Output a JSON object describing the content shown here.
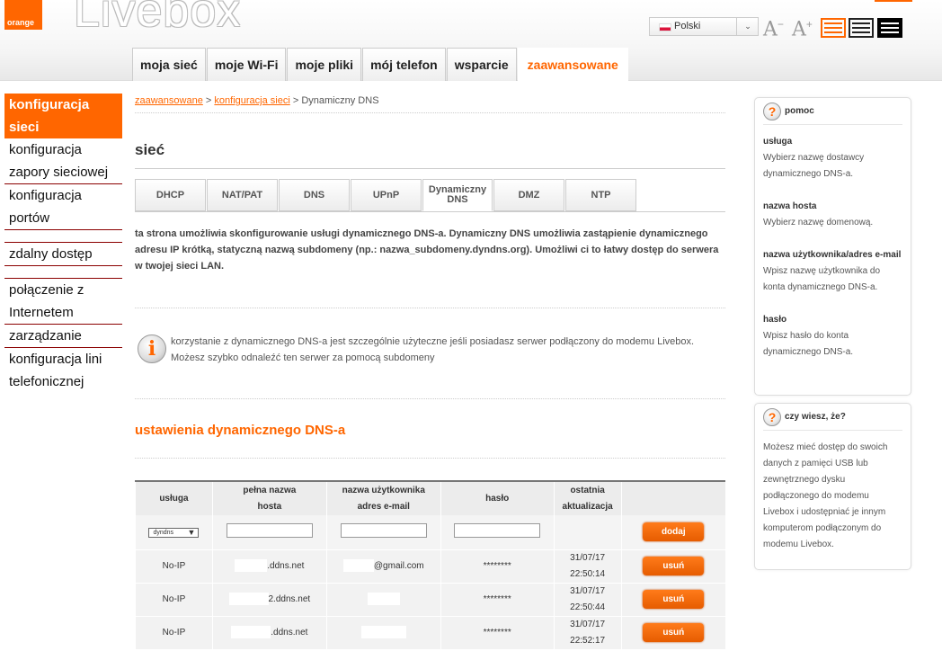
{
  "header": {
    "logo_text": "orange",
    "brand": "Livebox",
    "language": "Polski",
    "font_decrease": "A",
    "font_increase": "A",
    "font_decrease_mark": "−",
    "font_increase_mark": "+"
  },
  "main_tabs": [
    "moja sieć",
    "moje Wi-Fi",
    "moje pliki",
    "mój telefon",
    "wsparcie",
    "zaawansowane"
  ],
  "left_nav": [
    "konfiguracja sieci",
    "konfiguracja zapory sieciowej",
    "konfiguracja portów",
    "zdalny dostęp",
    "połączenie z Internetem",
    "zarządzanie",
    "konfiguracja lini telefonicznej"
  ],
  "breadcrumb": {
    "level1": "zaawansowane",
    "level2": "konfiguracja sieci",
    "sep": ">",
    "current": "Dynamiczny DNS"
  },
  "section_title": "sieć",
  "sub_tabs": [
    "DHCP",
    "NAT/PAT",
    "DNS",
    "UPnP",
    "Dynamiczny DNS",
    "DMZ",
    "NTP"
  ],
  "description": "ta strona umożliwia skonfigurowanie usługi dynamicznego DNS-a. Dynamiczny DNS umożliwia zastąpienie dynamicznego adresu IP krótką, statyczną nazwą subdomeny (np.: nazwa_subdomeny.dyndns.org). Umożliwi ci to łatwy dostęp do serwera w twojej sieci LAN.",
  "info": {
    "icon": "i",
    "text": "korzystanie z dynamicznego DNS-a jest szczególnie użyteczne jeśli posiadasz serwer podłączony do modemu Livebox. Możesz szybko odnaleźć ten serwer za pomocą subdomeny"
  },
  "settings_title": "ustawienia dynamicznego DNS-a",
  "table": {
    "headers": [
      "usługa",
      "pełna nazwa hosta",
      "nazwa użytkownika adres e-mail",
      "hasło",
      "ostatnia aktualizacja"
    ],
    "input_row": {
      "service_select": "dyndns",
      "host": "",
      "user": "",
      "password": "",
      "add_button": "dodaj"
    },
    "rows": [
      {
        "service": "No-IP",
        "host": ".ddns.net",
        "user": "@gmail.com",
        "password": "********",
        "date": "31/07/17",
        "time": "22:50:14",
        "button": "usuń"
      },
      {
        "service": "No-IP",
        "host": "2.ddns.net",
        "user": "",
        "password": "********",
        "date": "31/07/17",
        "time": "22:50:44",
        "button": "usuń"
      },
      {
        "service": "No-IP",
        "host": ".ddns.net",
        "user": "",
        "password": "********",
        "date": "31/07/17",
        "time": "22:52:17",
        "button": "usuń"
      }
    ]
  },
  "help": {
    "title": "pomoc",
    "icon": "?",
    "items": [
      {
        "label": "usługa",
        "desc": "Wybierz nazwę dostawcy dynamicznego DNS-a."
      },
      {
        "label": "nazwa hosta",
        "desc": "Wybierz nazwę domenową."
      },
      {
        "label": "nazwa użytkownika/adres e-mail",
        "desc": "Wpisz nazwę użytkownika do konta dynamicznego DNS-a."
      },
      {
        "label": "hasło",
        "desc": "Wpisz hasło do konta dynamicznego DNS-a."
      }
    ]
  },
  "tip": {
    "title": "czy wiesz, że?",
    "icon": "?",
    "text": "Możesz mieć dostęp do swoich danych z pamięci USB lub zewnętrznego dysku podłączonego do modemu Livebox i udostępniać je innym komputerom podłączonym do modemu Livebox."
  },
  "colors": {
    "accent": "#ff6600",
    "nav_border": "#8b0000"
  },
  "icons": {
    "select_arrow": "▼",
    "dropdown_chevron": "⌄"
  }
}
